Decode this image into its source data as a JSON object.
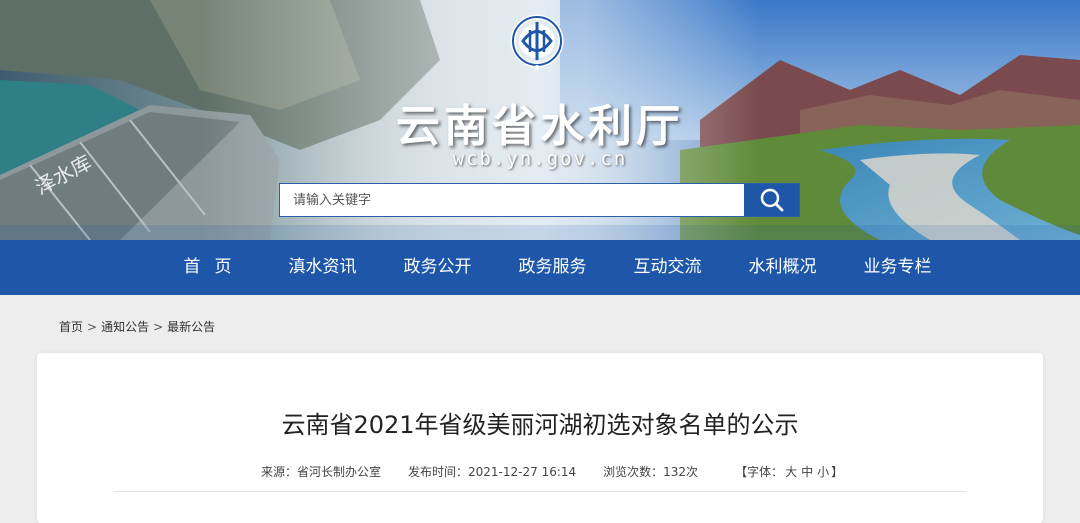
{
  "header": {
    "site_title": "云南省水利厅",
    "site_domain": "wcb.yn.gov.cn",
    "logo_icon": "water-resources-emblem-icon",
    "search": {
      "placeholder": "请输入关键字",
      "value": "",
      "button_icon": "search-icon"
    }
  },
  "nav": {
    "items": [
      {
        "label": "首页"
      },
      {
        "label": "滇水资讯"
      },
      {
        "label": "政务公开"
      },
      {
        "label": "政务服务"
      },
      {
        "label": "互动交流"
      },
      {
        "label": "水利概况"
      },
      {
        "label": "业务专栏"
      }
    ]
  },
  "breadcrumb": {
    "items": [
      "首页",
      "通知公告",
      "最新公告"
    ],
    "separator": ">"
  },
  "article": {
    "title": "云南省2021年省级美丽河湖初选对象名单的公示",
    "source": "来源：省河长制办公室",
    "publish_time": "发布时间：2021-12-27 16:14",
    "views": "浏览次数：132次",
    "font_size_prefix": "【字体：",
    "font_size_large": "大",
    "font_size_medium": "中",
    "font_size_small": "小",
    "font_size_suffix": "】"
  },
  "dam_inscription": "泽水库",
  "colors": {
    "nav_bg": "#1e57a9",
    "search_button": "#1f57a8",
    "page_bg": "#ededed"
  }
}
